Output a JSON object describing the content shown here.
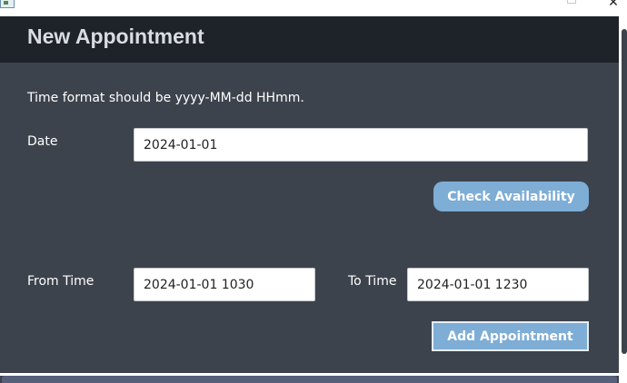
{
  "window": {
    "controls": {
      "minimize": "—",
      "maximize": "□",
      "close": "✕"
    }
  },
  "header": {
    "title": "New Appointment"
  },
  "form": {
    "hint": "Time format should be yyyy-MM-dd HHmm.",
    "date_label": "Date",
    "date_value": "2024-01-01",
    "check_button": "Check Availability",
    "from_label": "From Time",
    "from_value": "2024-01-01 1030",
    "to_label": "To Time",
    "to_value": "2024-01-01 1230",
    "add_button": "Add Appointment"
  }
}
